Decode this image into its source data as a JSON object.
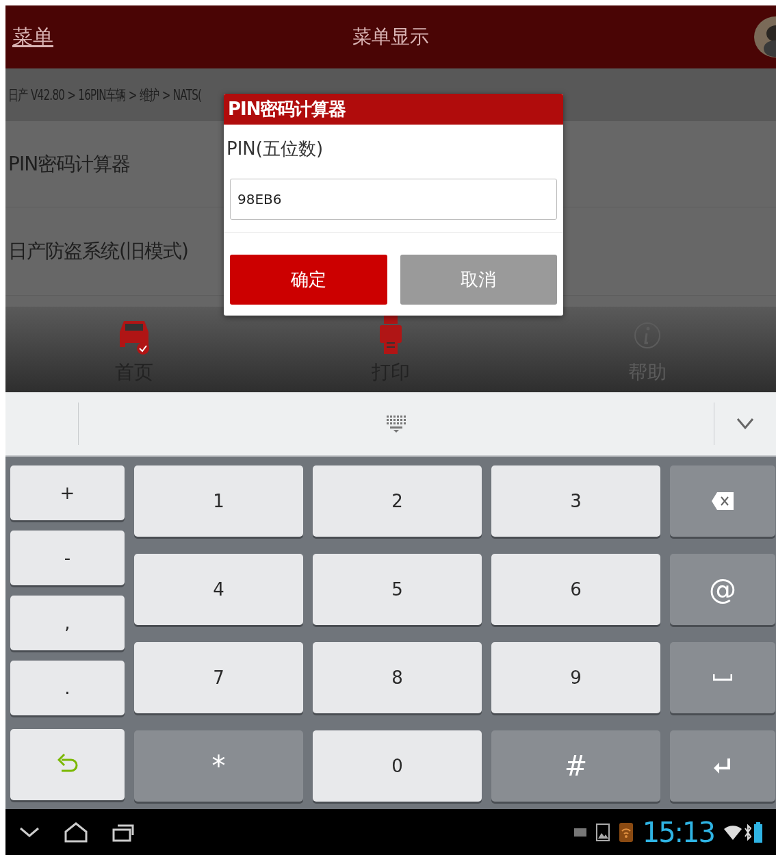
{
  "header": {
    "menu_link": "菜单",
    "title": "菜单显示"
  },
  "breadcrumb": "日产 V42.80 > 16PIN车辆 > 维护 > NATS(",
  "menu_items": [
    {
      "label": "PIN密码计算器"
    },
    {
      "label": "日产防盗系统(旧模式)"
    }
  ],
  "dialog": {
    "title": "PIN密码计算器",
    "field_label": "PIN(五位数)",
    "field_value": "98EB6",
    "buttons": [
      {
        "label": "确定",
        "kind": "primary"
      },
      {
        "label": "取消",
        "kind": "secondary"
      }
    ]
  },
  "toolbar": [
    {
      "label": "首页",
      "kind": "home",
      "disabled": false
    },
    {
      "label": "打印",
      "kind": "print",
      "disabled": false
    },
    {
      "label": "帮助",
      "kind": "help",
      "disabled": true
    }
  ],
  "keyboard": {
    "side_keys": [
      {
        "kind": "text",
        "label": "+",
        "dark": false
      },
      {
        "kind": "text",
        "label": "-",
        "dark": false
      },
      {
        "kind": "text",
        "label": ",",
        "dark": false
      },
      {
        "kind": "text",
        "label": ".",
        "dark": false
      },
      {
        "kind": "undo",
        "dark": false
      }
    ],
    "keys": [
      {
        "kind": "text",
        "label": "1",
        "dark": false
      },
      {
        "kind": "text",
        "label": "2",
        "dark": false
      },
      {
        "kind": "text",
        "label": "3",
        "dark": false
      },
      {
        "kind": "backspace",
        "dark": true
      },
      {
        "kind": "text",
        "label": "4",
        "dark": false
      },
      {
        "kind": "text",
        "label": "5",
        "dark": false
      },
      {
        "kind": "text",
        "label": "6",
        "dark": false
      },
      {
        "kind": "text",
        "label": "@",
        "dark": true
      },
      {
        "kind": "text",
        "label": "7",
        "dark": false
      },
      {
        "kind": "text",
        "label": "8",
        "dark": false
      },
      {
        "kind": "text",
        "label": "9",
        "dark": false
      },
      {
        "kind": "space",
        "dark": true
      },
      {
        "kind": "text",
        "label": "*",
        "dark": true
      },
      {
        "kind": "text",
        "label": "0",
        "dark": false
      },
      {
        "kind": "text",
        "label": "#",
        "dark": true
      },
      {
        "kind": "enter",
        "dark": true
      }
    ]
  },
  "status_bar": {
    "time": "15:13"
  }
}
